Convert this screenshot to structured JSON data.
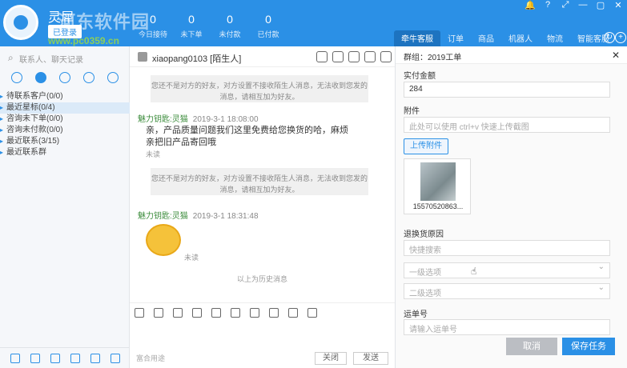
{
  "header": {
    "title": "灵犀",
    "status_label": "已登录",
    "watermark": "河东软件园",
    "watermark_url": "www.pc0359.cn",
    "stats": [
      {
        "value": "0",
        "label": "今日接待"
      },
      {
        "value": "0",
        "label": "未下单"
      },
      {
        "value": "0",
        "label": "未付款"
      },
      {
        "value": "0",
        "label": "已付款"
      }
    ],
    "tabs": [
      {
        "label": "牵牛客服",
        "active": true
      },
      {
        "label": "订单",
        "active": false
      },
      {
        "label": "商品",
        "active": false
      },
      {
        "label": "机器人",
        "active": false
      },
      {
        "label": "物流",
        "active": false
      },
      {
        "label": "智能客服",
        "active": false
      }
    ],
    "window_controls": [
      "🔔",
      "?",
      "⤢",
      "—",
      "▢",
      "✕"
    ]
  },
  "sidebar": {
    "search_placeholder": "联系人、聊天记录",
    "groups": [
      {
        "label": "待联系客户(0/0)",
        "selected": false
      },
      {
        "label": "最近星标(0/4)",
        "selected": true
      },
      {
        "label": "咨询未下单(0/0)",
        "selected": false
      },
      {
        "label": "咨询未付款(0/0)",
        "selected": false
      },
      {
        "label": "最近联系(3/15)",
        "selected": false
      },
      {
        "label": "最近联系群",
        "selected": false
      }
    ]
  },
  "chat": {
    "contact_name": "xiaopang0103 [陌生人]",
    "system_notice_1": "您还不是对方的好友，对方设置不接收陌生人消息，无法收到您发的消息，请相互加为好友。",
    "msg1_sender": "魅力钥匙:灵猫",
    "msg1_time": "2019-3-1 18:08:00",
    "msg1_text": "亲，产品质量问题我们这里免费给您换货的哈，麻烦亲把旧产品寄回哦",
    "msg1_status": "未读",
    "system_notice_2": "您还不是对方的好友，对方设置不接收陌生人消息，无法收到您发的消息，请相互加为好友。",
    "msg2_sender": "魅力钥匙:灵猫",
    "msg2_time": "2019-3-1 18:31:48",
    "msg2_status": "未读",
    "history_divider": "以上为历史消息",
    "quick_reply": "富合用途",
    "close_label": "关闭",
    "send_label": "发送"
  },
  "panel": {
    "group_title": "群组：2019工单",
    "paid_amount_label": "实付金额",
    "paid_amount_value": "284",
    "attachment_label": "附件",
    "attachment_placeholder": "此处可以使用 ctrl+v 快速上传截图",
    "upload_label": "上传附件",
    "attachment_filename": "15570520863...",
    "reason_label": "退换货原因",
    "reason_placeholder": "快捷搜索",
    "level1_placeholder": "一级选项",
    "level2_placeholder": "二级选项",
    "waybill_label": "运单号",
    "waybill_placeholder": "请输入运单号",
    "cancel_label": "取消",
    "save_label": "保存任务"
  }
}
